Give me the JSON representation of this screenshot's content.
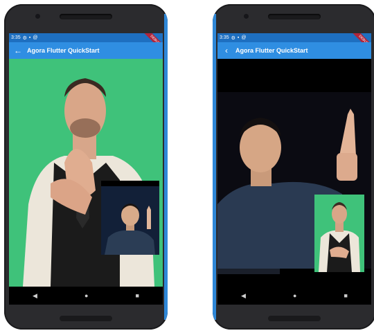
{
  "phones": [
    {
      "status": {
        "time": "3:35"
      },
      "appbar": {
        "title": "Agora Flutter QuickStart",
        "back": "←"
      },
      "debug_banner": "DEBUG",
      "navbar": {
        "back": "◀",
        "home": "●",
        "recent": "■"
      },
      "main_video": {
        "background": "#3fc27a"
      },
      "pip_video": {
        "background": "#122038"
      }
    },
    {
      "status": {
        "time": "3:35"
      },
      "appbar": {
        "title": "Agora Flutter QuickStart",
        "back": "‹"
      },
      "debug_banner": "DEBUG",
      "navbar": {
        "back": "◀",
        "home": "●",
        "recent": "■"
      },
      "main_video": {
        "background": "#0b0b12"
      },
      "pip_video": {
        "background": "#3fc27a"
      }
    }
  ]
}
